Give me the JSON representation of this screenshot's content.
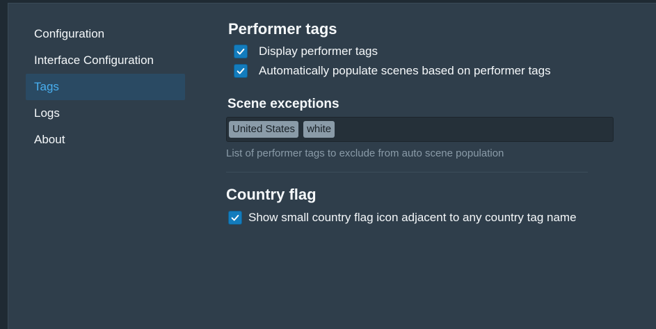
{
  "sidebar": {
    "items": [
      {
        "label": "Configuration",
        "active": false
      },
      {
        "label": "Interface Configuration",
        "active": false
      },
      {
        "label": "Tags",
        "active": true
      },
      {
        "label": "Logs",
        "active": false
      },
      {
        "label": "About",
        "active": false
      }
    ]
  },
  "performer_tags": {
    "title": "Performer tags",
    "options": [
      {
        "label": "Display performer tags",
        "checked": true
      },
      {
        "label": "Automatically populate scenes based on performer tags",
        "checked": true
      }
    ]
  },
  "scene_exceptions": {
    "title": "Scene exceptions",
    "tags": [
      "United States",
      "white"
    ],
    "help": "List of performer tags to exclude from auto scene population"
  },
  "country_flag": {
    "title": "Country flag",
    "option": {
      "label": "Show small country flag icon adjacent to any country tag name",
      "checked": true
    }
  },
  "colors": {
    "accent": "#48aff0",
    "checkbox": "#137cbd",
    "background": "#2f3e4b",
    "tag": "#8a9ba8"
  },
  "icons": {
    "checkbox_checked": "check-icon"
  }
}
